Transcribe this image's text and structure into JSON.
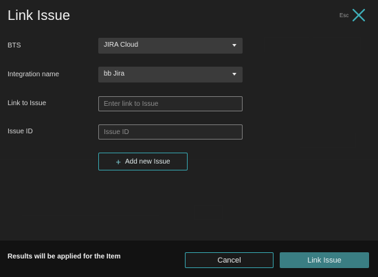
{
  "modal": {
    "title": "Link Issue",
    "esc_hint": "Esc",
    "close_icon": "close-x-icon"
  },
  "form": {
    "bts": {
      "label": "BTS",
      "value": "JIRA Cloud"
    },
    "integration": {
      "label": "Integration name",
      "value": "bb Jira"
    },
    "link": {
      "label": "Link to Issue",
      "placeholder": "Enter link to Issue",
      "value": ""
    },
    "issue_id": {
      "label": "Issue ID",
      "placeholder": "Issue ID",
      "value": ""
    },
    "add_new_issue": "Add new Issue"
  },
  "footer": {
    "note": "Results will be applied for the Item",
    "cancel": "Cancel",
    "submit": "Link Issue"
  },
  "colors": {
    "accent": "#37a3ad",
    "primary_button": "#3a7e83",
    "footer_bg": "#121212",
    "modal_bg": "#202020"
  }
}
